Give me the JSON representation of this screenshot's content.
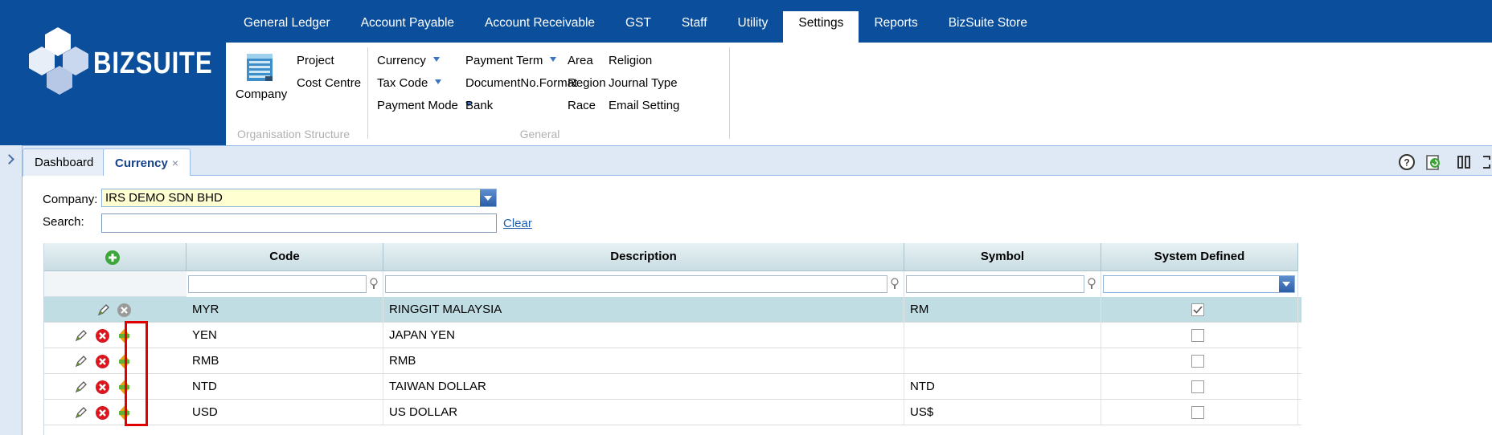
{
  "app": {
    "logo_text": "BIZSUITE"
  },
  "nav": {
    "tabs": [
      {
        "label": "General Ledger"
      },
      {
        "label": "Account Payable"
      },
      {
        "label": "Account Receivable"
      },
      {
        "label": "GST"
      },
      {
        "label": "Staff"
      },
      {
        "label": "Utility"
      },
      {
        "label": "Settings",
        "active": true
      },
      {
        "label": "Reports"
      },
      {
        "label": "BizSuite Store"
      }
    ]
  },
  "ribbon": {
    "org": {
      "label": "Organisation Structure",
      "company": "Company",
      "project": "Project",
      "cost_centre": "Cost Centre"
    },
    "general": {
      "label": "General",
      "currency": "Currency",
      "tax_code": "Tax Code",
      "payment_mode": "Payment Mode",
      "payment_term": "Payment Term",
      "doc_no_format": "DocumentNo.Format",
      "bank": "Bank",
      "area": "Area",
      "region": "Region",
      "race": "Race",
      "religion": "Religion",
      "journal_type": "Journal Type",
      "email_setting": "Email Setting"
    }
  },
  "panel_tabs": {
    "dashboard": "Dashboard",
    "currency": "Currency",
    "close": "×"
  },
  "form": {
    "company_label": "Company:",
    "company_value": "IRS DEMO SDN BHD",
    "search_label": "Search:",
    "search_value": "",
    "clear_label": "Clear"
  },
  "grid": {
    "columns": {
      "code": "Code",
      "description": "Description",
      "symbol": "Symbol",
      "system_defined": "System Defined"
    },
    "rows": [
      {
        "code": "MYR",
        "description": "RINGGIT MALAYSIA",
        "symbol": "RM",
        "system_defined": true,
        "selected": true
      },
      {
        "code": "YEN",
        "description": "JAPAN YEN",
        "symbol": "",
        "system_defined": false
      },
      {
        "code": "RMB",
        "description": "RMB",
        "symbol": "",
        "system_defined": false
      },
      {
        "code": "NTD",
        "description": "TAIWAN DOLLAR",
        "symbol": "NTD",
        "system_defined": false
      },
      {
        "code": "USD",
        "description": "US DOLLAR",
        "symbol": "US$",
        "system_defined": false
      }
    ]
  },
  "colors": {
    "brand_blue": "#0b4f9c",
    "selected_row": "#c0dde3",
    "highlight": "#e00000"
  }
}
